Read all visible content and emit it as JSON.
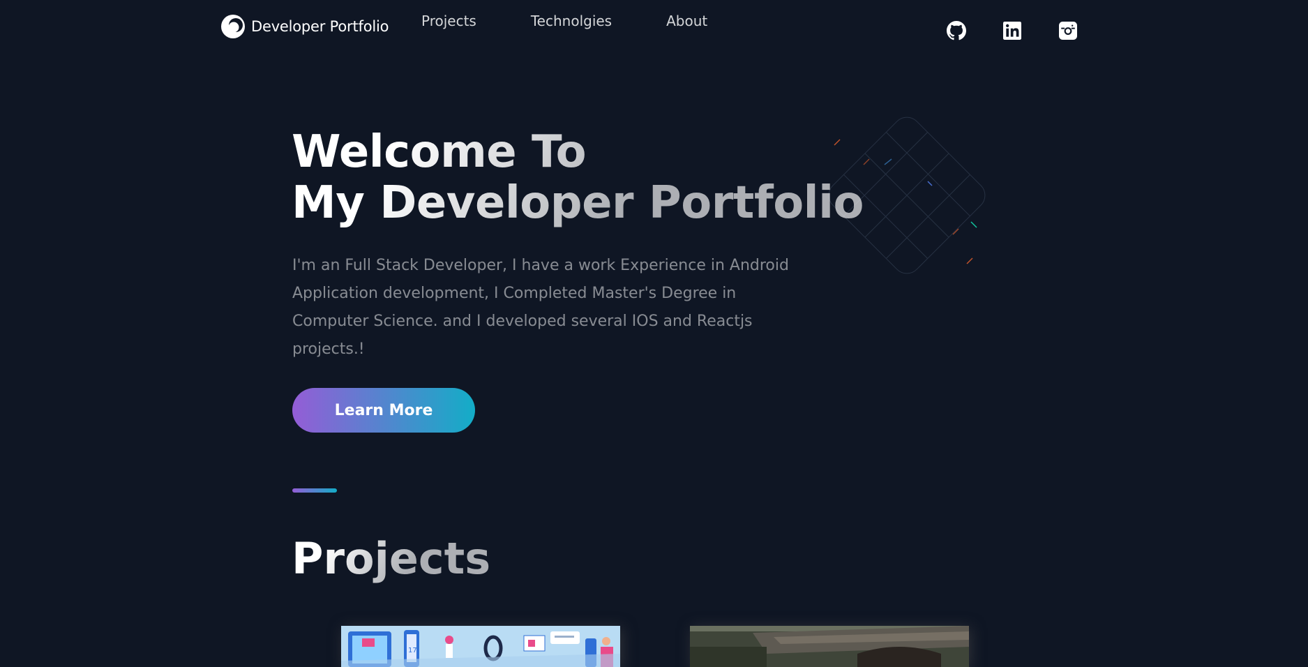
{
  "header": {
    "logo_text": "Developer Portfolio",
    "logo_icon": "portfolio-logo-icon",
    "nav": [
      "Projects",
      "Technolgies",
      "About"
    ],
    "social": [
      "github-icon",
      "linkedin-icon",
      "instagram-icon"
    ]
  },
  "hero": {
    "title_line1": "Welcome To",
    "title_line2": "My Developer Portfolio",
    "description": "I'm an Full Stack Developer, I have a work Experience in Android Application development, I Completed Master's Degree in Computer Science. and I developed several IOS and Reactjs projects.!",
    "button": "Learn More"
  },
  "projects": {
    "title": "Projects"
  },
  "colors": {
    "background": "#0f1624",
    "gradient_start": "#945dd6",
    "gradient_end": "#13adc7"
  }
}
